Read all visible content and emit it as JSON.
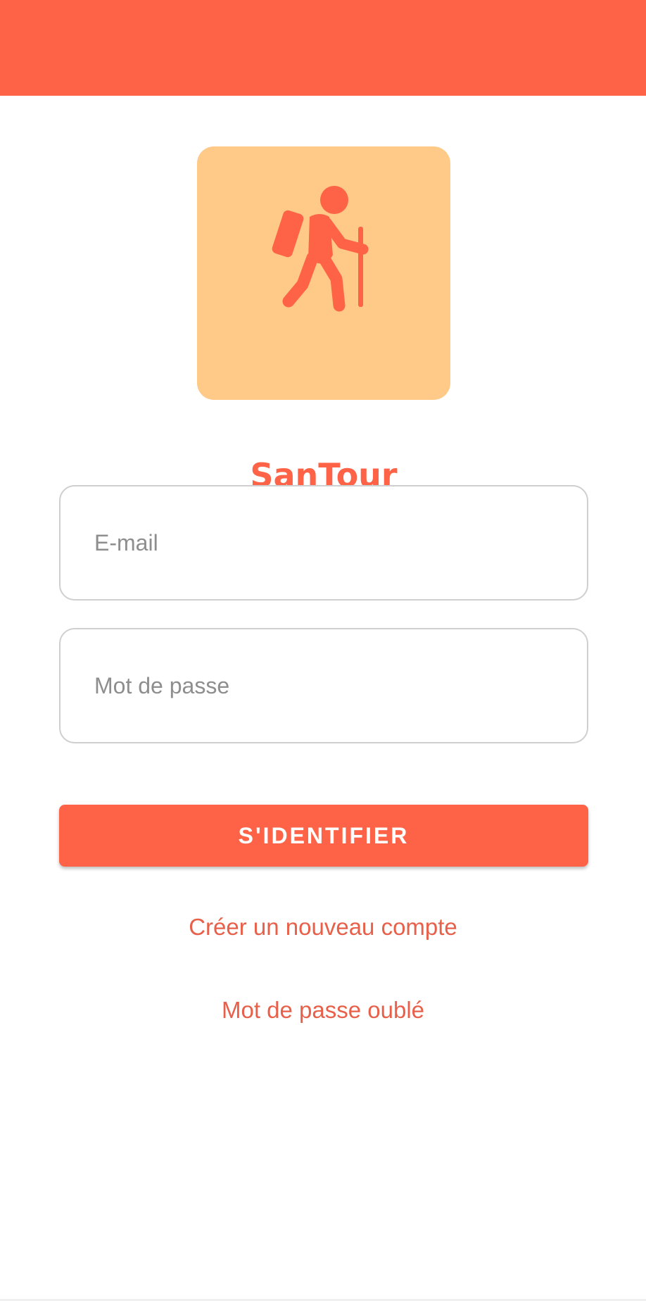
{
  "app": {
    "name": "SanTour",
    "accent_color": "#FF6347",
    "logo_background": "#FFC987"
  },
  "logo": {
    "icon": "hiker-icon",
    "text": "SanTour"
  },
  "form": {
    "email_placeholder": "E-mail",
    "email_value": "",
    "password_placeholder": "Mot de passe",
    "password_value": "",
    "login_label": "S'IDENTIFIER"
  },
  "links": {
    "create_account": "Créer un nouveau compte",
    "forgot_password": "Mot de passe oublé"
  }
}
